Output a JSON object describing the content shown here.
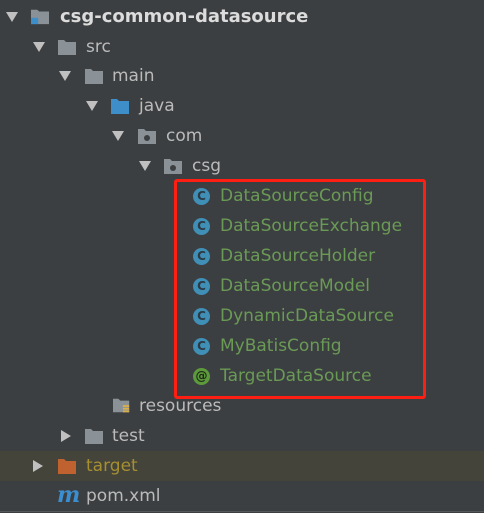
{
  "tree": {
    "root": {
      "label": "csg-common-datasource"
    },
    "src": {
      "label": "src"
    },
    "main": {
      "label": "main"
    },
    "java": {
      "label": "java"
    },
    "com": {
      "label": "com"
    },
    "csg": {
      "label": "csg"
    },
    "classes": [
      {
        "label": "DataSourceConfig",
        "icon": "class-icon",
        "badge": "C"
      },
      {
        "label": "DataSourceExchange",
        "icon": "class-icon",
        "badge": "C"
      },
      {
        "label": "DataSourceHolder",
        "icon": "class-icon",
        "badge": "C"
      },
      {
        "label": "DataSourceModel",
        "icon": "class-icon",
        "badge": "C"
      },
      {
        "label": "DynamicDataSource",
        "icon": "class-icon",
        "badge": "C"
      },
      {
        "label": "MyBatisConfig",
        "icon": "class-icon",
        "badge": "C"
      },
      {
        "label": "TargetDataSource",
        "icon": "annotation-icon",
        "badge": "@"
      }
    ],
    "resources": {
      "label": "resources"
    },
    "test": {
      "label": "test"
    },
    "target": {
      "label": "target"
    },
    "pom": {
      "label": "pom.xml",
      "icon_glyph": "m"
    }
  },
  "colors": {
    "background": "#3c3f41",
    "class_text": "#6a9a55",
    "target_text": "#a58f31",
    "highlight": "#ff1e12",
    "folder_gray": "#8a9197",
    "folder_blue": "#3d8ec9",
    "folder_orange": "#c0622f"
  }
}
